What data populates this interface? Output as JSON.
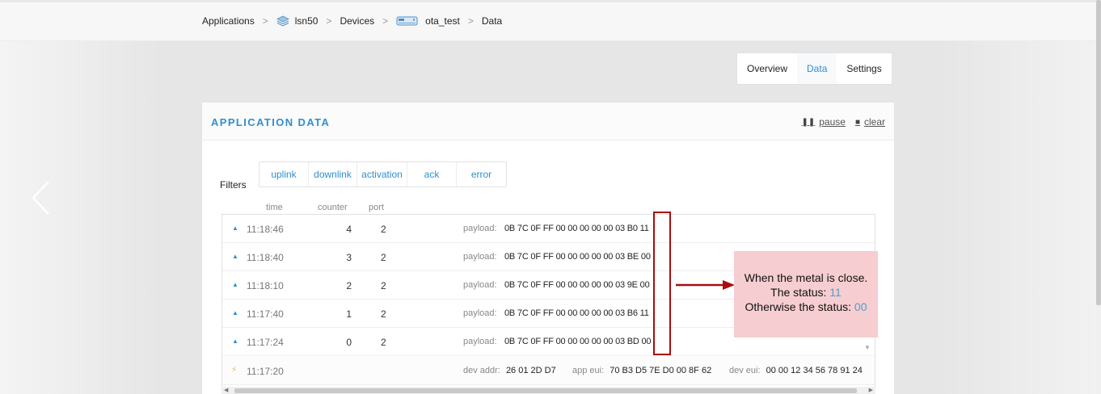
{
  "breadcrumb": {
    "items": [
      {
        "label": "Applications"
      },
      {
        "label": "lsn50",
        "icon": "stack-icon"
      },
      {
        "label": "Devices"
      },
      {
        "label": "ota_test",
        "icon": "device-icon"
      },
      {
        "label": "Data"
      }
    ],
    "separator": ">"
  },
  "tabs": [
    {
      "label": "Overview",
      "active": false
    },
    {
      "label": "Data",
      "active": true
    },
    {
      "label": "Settings",
      "active": false
    }
  ],
  "panel": {
    "title": "APPLICATION DATA",
    "pause_label": "pause",
    "clear_label": "clear"
  },
  "filters": {
    "label": "Filters",
    "items": [
      "uplink",
      "downlink",
      "activation",
      "ack",
      "error"
    ]
  },
  "columns": {
    "time": "time",
    "counter": "counter",
    "port": "port"
  },
  "rows": [
    {
      "type": "uplink",
      "time": "11:18:46",
      "counter": "4",
      "port": "2",
      "payload_label": "payload:",
      "payload": "0B 7C 0F FF 00 00 00 00 00 03 B0 11"
    },
    {
      "type": "uplink",
      "time": "11:18:40",
      "counter": "3",
      "port": "2",
      "payload_label": "payload:",
      "payload": "0B 7C 0F FF 00 00 00 00 00 03 BE 00"
    },
    {
      "type": "uplink",
      "time": "11:18:10",
      "counter": "2",
      "port": "2",
      "payload_label": "payload:",
      "payload": "0B 7C 0F FF 00 00 00 00 00 03 9E 00"
    },
    {
      "type": "uplink",
      "time": "11:17:40",
      "counter": "1",
      "port": "2",
      "payload_label": "payload:",
      "payload": "0B 7C 0F FF 00 00 00 00 00 03 B6 11"
    },
    {
      "type": "uplink",
      "time": "11:17:24",
      "counter": "0",
      "port": "2",
      "payload_label": "payload:",
      "payload": "0B 7C 0F FF 00 00 00 00 00 03 BD 00"
    }
  ],
  "activation_row": {
    "time": "11:17:20",
    "dev_addr_label": "dev addr:",
    "dev_addr": "26 01 2D D7",
    "app_eui_label": "app eui:",
    "app_eui": "70 B3 D5 7E D0 00 8F 62",
    "dev_eui_label": "dev eui:",
    "dev_eui": "00 00 12 34 56 78 91 24"
  },
  "annotation": {
    "line1": "When the metal is close.",
    "line2_prefix": "The status: ",
    "line2_value": "11",
    "line3_prefix": "Otherwise the status: ",
    "line3_value": "00",
    "box_color": "#a80d0d",
    "note_bg": "#f6cdd0"
  },
  "colors": {
    "accent": "#2e8fd1",
    "activation": "#f2b544"
  }
}
